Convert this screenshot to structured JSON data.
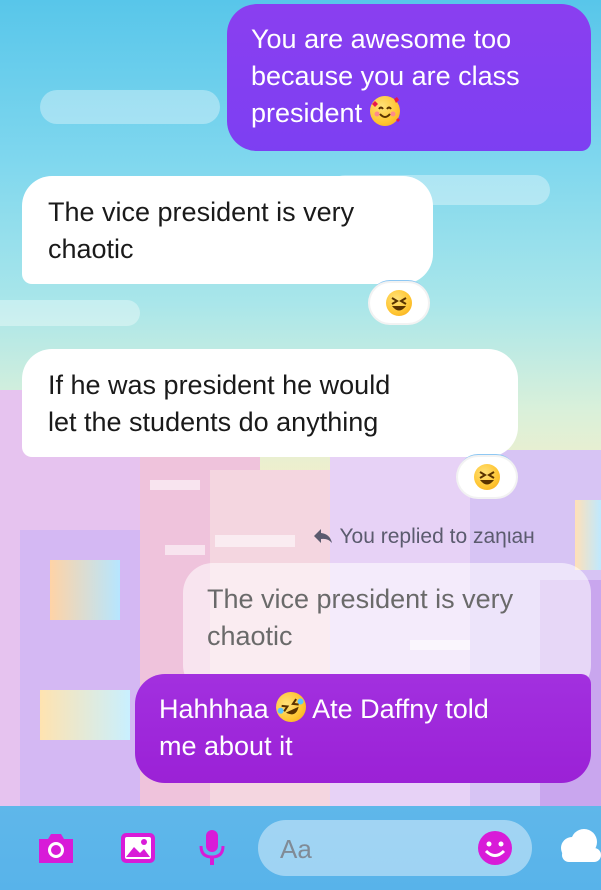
{
  "messages": {
    "m1": {
      "lines": [
        "You are awesome too",
        "because you are class",
        "president"
      ]
    },
    "m2": {
      "lines": [
        "The vice president is very",
        "chaotic"
      ]
    },
    "m3": {
      "lines": [
        "If he was president he would",
        "let the students do anything"
      ]
    },
    "reply_context": {
      "label": "You replied to zaηιaн",
      "quoted_lines": [
        "The vice president is very",
        "chaotic"
      ]
    },
    "m4": {
      "line1_a": "Hahhhaa",
      "line1_b": "Ate Daffny told",
      "line2": "me about it"
    }
  },
  "reactions": {
    "m2": "grinning-squinting-face",
    "m3": "grinning-squinting-face"
  },
  "composer": {
    "placeholder": "Aa",
    "icons": [
      "camera-icon",
      "image-icon",
      "microphone-icon",
      "emoji-icon",
      "cloud-icon"
    ]
  },
  "colors": {
    "outgoing": "#7d3ff2",
    "outgoing_last": "#9b21d6",
    "accent": "#d81bd8",
    "composer_bg": "#58b3ea"
  }
}
